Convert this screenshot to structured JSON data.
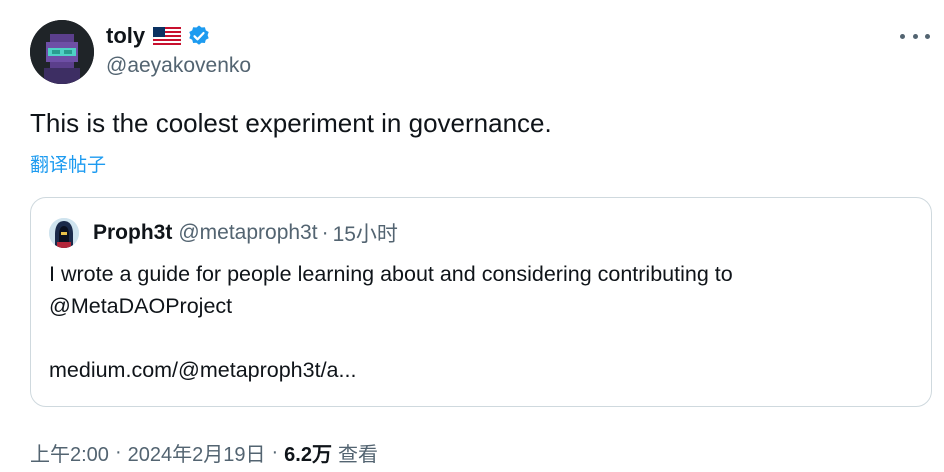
{
  "author": {
    "name": "toly",
    "handle": "@aeyakovenko",
    "flag_icon": "us-flag-icon",
    "verified_icon": "verified-badge-icon",
    "verified_color": "#1d9bf0"
  },
  "tweet": {
    "text": "This is the coolest experiment in governance.",
    "translate_label": "翻译帖子"
  },
  "quote": {
    "name": "Proph3t",
    "handle": "@metaproph3t",
    "separator": "·",
    "time": "15小时",
    "lines": [
      "I wrote a guide for people learning about and considering contributing to",
      "@MetaDAOProject",
      "medium.com/@metaproph3t/a..."
    ]
  },
  "meta": {
    "time": "上午2:00",
    "separator": "·",
    "date": "2024年2月19日",
    "views_count": "6.2万",
    "views_label": "查看"
  },
  "colors": {
    "text": "#0f1419",
    "secondary": "#536471",
    "link": "#1d9bf0",
    "border": "#cfd9de"
  }
}
